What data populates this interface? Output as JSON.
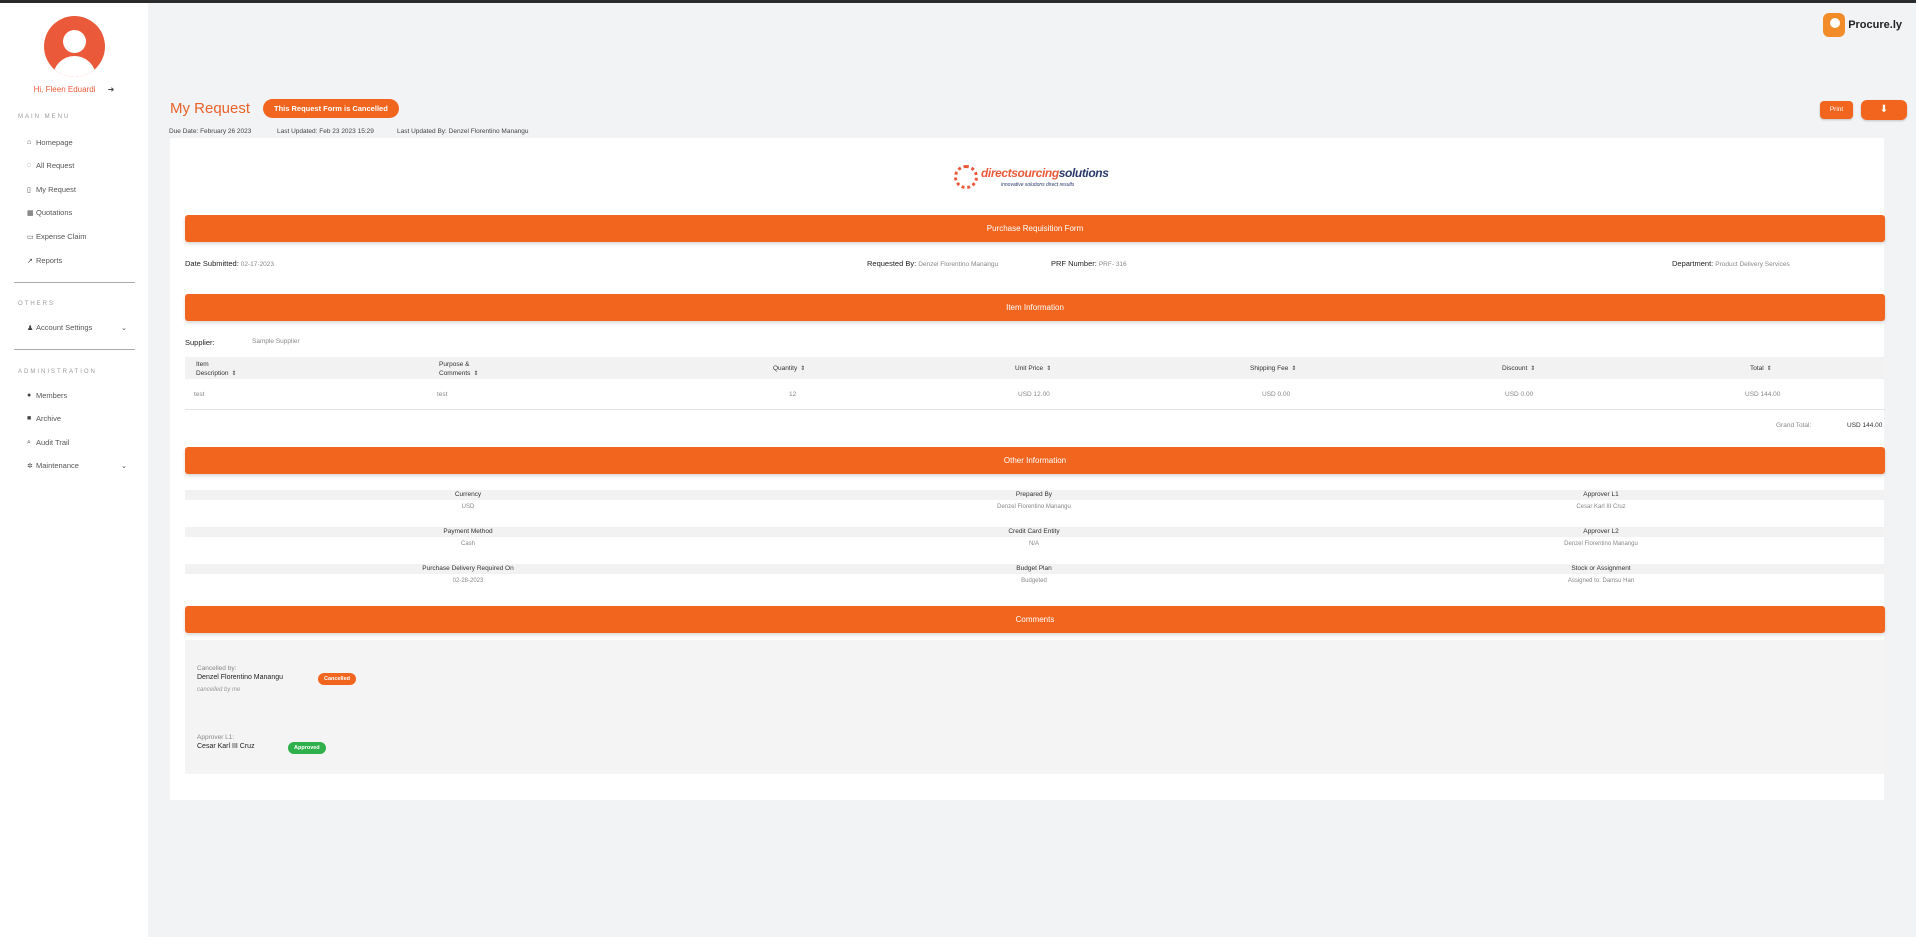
{
  "sidebar": {
    "greeting": "Hi, Fleen Eduardi",
    "main_menu_title": "MAIN MENU",
    "main_menu": [
      {
        "icon": "home-icon",
        "glyph": "⌂",
        "label": "Homepage"
      },
      {
        "icon": "chat-icon",
        "glyph": "◌",
        "label": "All Request"
      },
      {
        "icon": "document-icon",
        "glyph": "▯",
        "label": "My Request"
      },
      {
        "icon": "table-icon",
        "glyph": "▦",
        "label": "Quotations"
      },
      {
        "icon": "card-icon",
        "glyph": "▭",
        "label": "Expense Claim"
      },
      {
        "icon": "chart-icon",
        "glyph": "↗",
        "label": "Reports"
      }
    ],
    "others_title": "OTHERS",
    "account_settings": "Account Settings",
    "admin_title": "ADMINISTRATION",
    "admin_menu": [
      {
        "icon": "users-icon",
        "glyph": "●",
        "label": "Members"
      },
      {
        "icon": "archive-icon",
        "glyph": "■",
        "label": "Archive"
      },
      {
        "icon": "search-icon",
        "glyph": "⌕",
        "label": "Audit Trail"
      },
      {
        "icon": "gears-icon",
        "glyph": "✲",
        "label": "Maintenance"
      }
    ]
  },
  "brand": {
    "name": "Procure.ly"
  },
  "header": {
    "title": "My Request",
    "status_pill": "This Request Form is Cancelled",
    "due_date": "Due Date: February 26 2023",
    "last_updated": "Last Updated: Feb 23 2023 15:29",
    "last_updated_by": "Last Updated By: Denzel Florentino Manangu",
    "print_label": "Print",
    "download_icon": "download-icon"
  },
  "company": {
    "name_a": "directsourcing",
    "name_b": "solutions",
    "tagline": "innovative solutions direct results"
  },
  "form": {
    "section_title": "Purchase Requisition Form",
    "date_submitted_label": "Date Submitted:",
    "date_submitted": "02-17-2023",
    "requested_by_label": "Requested By:",
    "requested_by": "Denzel Florentino Manangu",
    "prf_label": "PRF Number:",
    "prf": "PRF- 316",
    "department_label": "Department:",
    "department": "Product Delivery Services"
  },
  "items": {
    "section_title": "Item Information",
    "supplier_label": "Supplier:",
    "supplier": "Sample Supplier",
    "headers": [
      "Item Description",
      "Purpose & Comments",
      "Quantity",
      "Unit Price",
      "Shipping Fee",
      "Discount",
      "Total"
    ],
    "rows": [
      [
        "test",
        "test",
        "12",
        "USD 12.00",
        "USD 0.00",
        "USD 0.00",
        "USD 144.00"
      ]
    ],
    "grand_total_label": "Grand Total:",
    "grand_total": "USD 144.00"
  },
  "other": {
    "section_title": "Other Information",
    "fields": [
      {
        "label": "Currency",
        "value": "USD"
      },
      {
        "label": "Prepared By",
        "value": "Denzel Florentino Manangu"
      },
      {
        "label": "Approver L1",
        "value": "Cesar Karl III Cruz"
      },
      {
        "label": "Payment Method",
        "value": "Cash"
      },
      {
        "label": "Credit Card Entity",
        "value": "N/A"
      },
      {
        "label": "Approver L2",
        "value": "Denzel Florentino Manangu"
      },
      {
        "label": "Purchase Delivery Required On",
        "value": "02-28-2023"
      },
      {
        "label": "Budget Plan",
        "value": "Budgeted"
      },
      {
        "label": "Stock or Assignment",
        "value": "Assigned to: Damsu Han"
      }
    ]
  },
  "comments": {
    "section_title": "Comments",
    "entries": [
      {
        "role": "Cancelled by:",
        "name": "Denzel Florentino Manangu",
        "note": "cancelled by me",
        "status": "Cancelled"
      },
      {
        "role": "Approver L1:",
        "name": "Cesar Karl III Cruz",
        "note": "",
        "status": "Approved"
      }
    ]
  },
  "colors": {
    "accent": "#f2651f",
    "approved": "#2fb04a",
    "background": "#f2f3f5"
  }
}
